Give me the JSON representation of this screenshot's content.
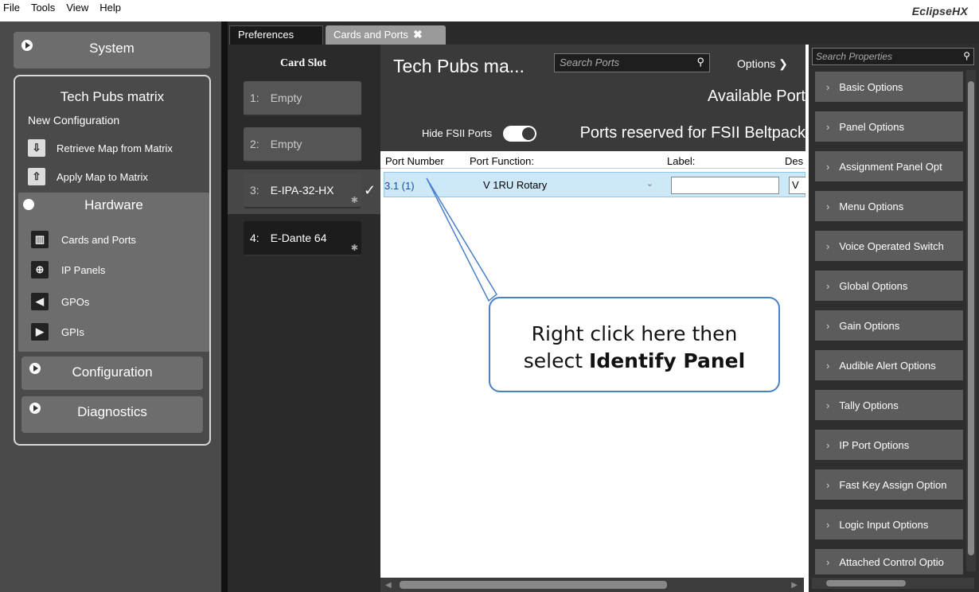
{
  "menubar": {
    "items": [
      "File",
      "Tools",
      "View",
      "Help"
    ],
    "brand": "EclipseHX"
  },
  "sidebar": {
    "system": "System",
    "matrix_title": "Tech Pubs matrix",
    "new_config": "New Configuration",
    "retrieve": "Retrieve Map from Matrix",
    "apply": "Apply Map to Matrix",
    "hardware": "Hardware",
    "hw_items": [
      "Cards and Ports",
      "IP Panels",
      "GPOs",
      "GPIs"
    ],
    "configuration": "Configuration",
    "diagnostics": "Diagnostics"
  },
  "tabs": {
    "preferences": "Preferences",
    "cards": "Cards and Ports",
    "close": "✖"
  },
  "cardslot": {
    "header": "Card Slot",
    "slots": [
      {
        "num": "1:",
        "label": "Empty"
      },
      {
        "num": "2:",
        "label": "Empty"
      },
      {
        "num": "3:",
        "label": "E-IPA-32-HX"
      },
      {
        "num": "4:",
        "label": "E-Dante 64"
      }
    ],
    "check": "✓"
  },
  "main": {
    "title": "Tech Pubs ma...",
    "search_placeholder": "Search Ports",
    "options": "Options ❯",
    "available": "Available Port",
    "hide_fsii": "Hide FSII Ports",
    "reserved": "Ports reserved for FSII Beltpack",
    "columns": [
      "Port Number",
      "Port Function:",
      "Label:",
      "Des"
    ],
    "row": {
      "port": "3.1 (1)",
      "function": "V 1RU Rotary",
      "desc": "V"
    }
  },
  "callout": {
    "line1": "Right click here then",
    "line2_prefix": "select ",
    "line2_bold": "Identify Panel"
  },
  "properties": {
    "search_placeholder": "Search Properties",
    "items": [
      "Basic Options",
      "Panel Options",
      "Assignment Panel Opt",
      "Menu Options",
      "Voice Operated Switch",
      "Global Options",
      "Gain Options",
      "Audible Alert Options",
      "Tally Options",
      "IP Port Options",
      "Fast Key Assign Option",
      "Logic Input Options",
      "Attached Control Optio"
    ]
  }
}
